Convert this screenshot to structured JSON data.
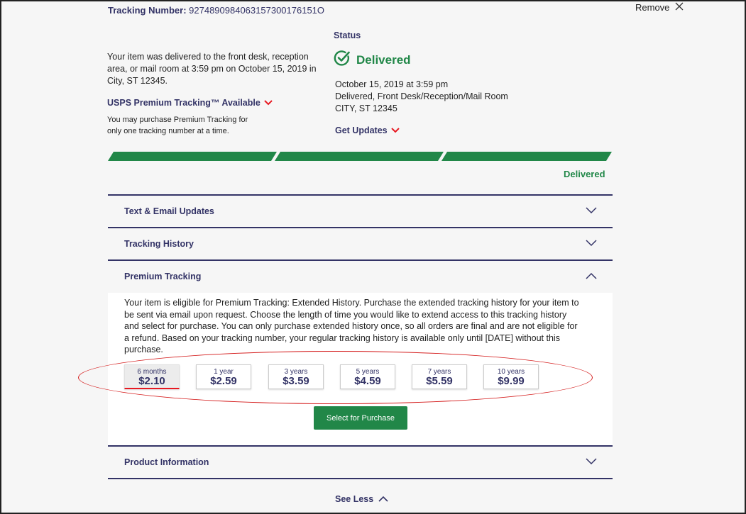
{
  "header": {
    "tracking_label": "Tracking Number:",
    "tracking_number": "9274890984063157300176151O",
    "remove_label": "Remove"
  },
  "summary": {
    "text": "Your item was delivered to the front desk, reception area, or mail room at 3:59 pm on October 15, 2019 in City, ST 12345.",
    "premium_available": "USPS Premium Tracking™ Available",
    "premium_note": "You may purchase Premium Tracking for only one tracking number at a time."
  },
  "status": {
    "label": "Status",
    "value": "Delivered",
    "date": "October 15, 2019 at 3:59 pm",
    "location": "Delivered, Front Desk/Reception/Mail Room",
    "city": "CITY, ST 12345",
    "get_updates": "Get Updates"
  },
  "progress": {
    "label": "Delivered",
    "completed_segments": 3,
    "total_segments": 3
  },
  "accordion": {
    "text_email": "Text & Email Updates",
    "tracking_history": "Tracking History",
    "premium_tracking": "Premium Tracking",
    "product_information": "Product Information"
  },
  "premium": {
    "description": "Your item is eligible for Premium Tracking: Extended History. Purchase the extended tracking history for your item to be sent via email upon request. Choose the length of time you would like to extend access to this tracking history and select for purchase. You can only purchase extended history once, so all orders are final and are not eligible for a refund. Based on your tracking number, your regular tracking history is available only until [DATE] without this purchase.",
    "options": [
      {
        "duration": "6 months",
        "price": "$2.10",
        "selected": true
      },
      {
        "duration": "1 year",
        "price": "$2.59",
        "selected": false
      },
      {
        "duration": "3 years",
        "price": "$3.59",
        "selected": false
      },
      {
        "duration": "5 years",
        "price": "$4.59",
        "selected": false
      },
      {
        "duration": "7 years",
        "price": "$5.59",
        "selected": false
      },
      {
        "duration": "10 years",
        "price": "$9.99",
        "selected": false
      }
    ],
    "button_label": "Select for Purchase"
  },
  "footer": {
    "see_less": "See Less"
  },
  "colors": {
    "brand_navy": "#333366",
    "success_green": "#218748",
    "accent_red": "#e71921",
    "annotation_red": "#d41a1a"
  },
  "icons": {
    "remove": "close-icon",
    "delivered": "check-circle-icon",
    "dropdown": "chevron-down-icon",
    "collapse": "chevron-up-icon"
  }
}
